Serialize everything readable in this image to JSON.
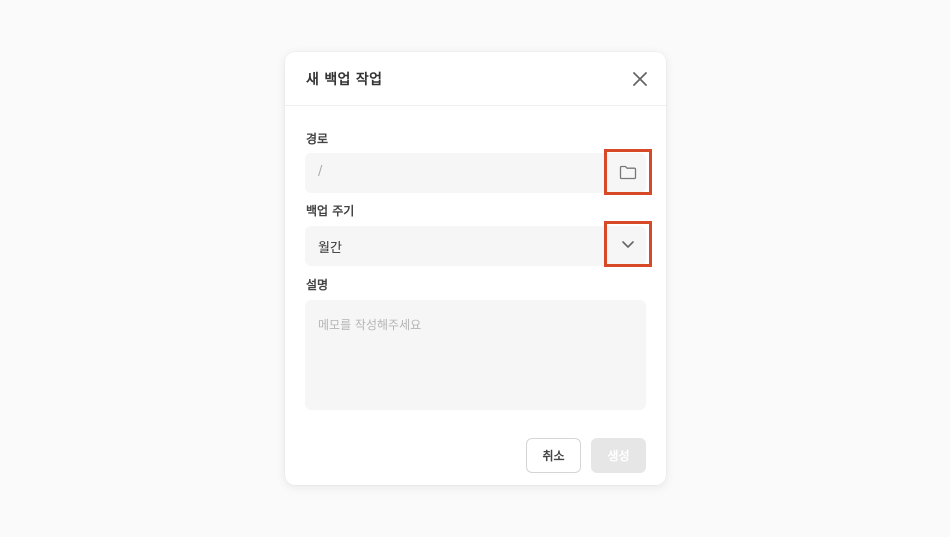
{
  "dialog": {
    "title": "새 백업 작업",
    "path": {
      "label": "경로",
      "value": "/"
    },
    "schedule": {
      "label": "백업 주기",
      "selected": "월간"
    },
    "description": {
      "label": "설명",
      "placeholder": "메모를 작성해주세요"
    },
    "buttons": {
      "cancel": "취소",
      "create": "생성"
    }
  },
  "colors": {
    "highlight": "#d84a27",
    "input_bg": "#f6f6f6",
    "disabled_button": "#e6e6e6"
  },
  "icons": {
    "close": "close-icon",
    "browse": "folder-icon",
    "dropdown": "chevron-down-icon"
  }
}
